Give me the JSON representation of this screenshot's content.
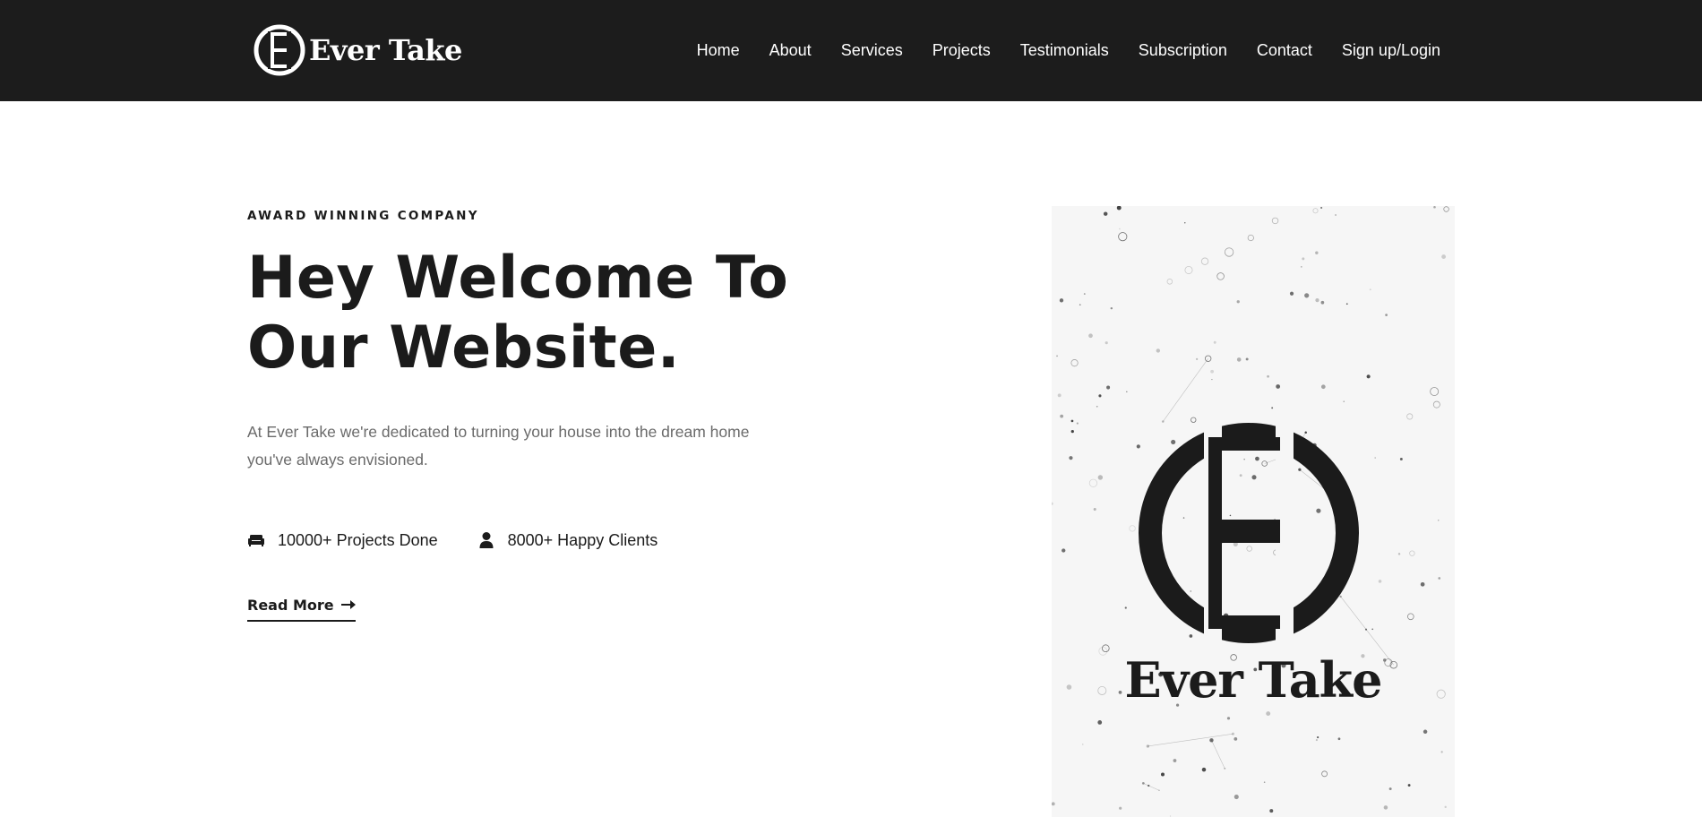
{
  "header": {
    "brand_name": "Ever Take",
    "logo_icon": "ever-take-e-logo",
    "nav": [
      {
        "label": "Home"
      },
      {
        "label": "About"
      },
      {
        "label": "Services"
      },
      {
        "label": "Projects"
      },
      {
        "label": "Testimonials"
      },
      {
        "label": "Subscription"
      },
      {
        "label": "Contact"
      },
      {
        "label": "Sign up/Login"
      }
    ],
    "background_color": "#1c1c1c",
    "text_color": "#ffffff"
  },
  "hero": {
    "eyebrow": "AWARD WINNING COMPANY",
    "headline_line1": "Hey Welcome To",
    "headline_line2": "Our Website.",
    "description": "At Ever Take we're dedicated to turning your house into the dream home you've always envisioned.",
    "stats": [
      {
        "icon": "sofa-icon",
        "label": "10000+ Projects Done"
      },
      {
        "icon": "user-icon",
        "label": "8000+ Happy Clients"
      }
    ],
    "cta_label": "Read More",
    "cta_icon": "arrow-right-icon",
    "image": {
      "logo_text": "Ever Take",
      "description_icon": "ever-take-logo-on-constellation-background"
    }
  },
  "colors": {
    "text_dark": "#1b1b1b",
    "text_muted": "#6a6a6a",
    "page_background": "#ffffff"
  }
}
